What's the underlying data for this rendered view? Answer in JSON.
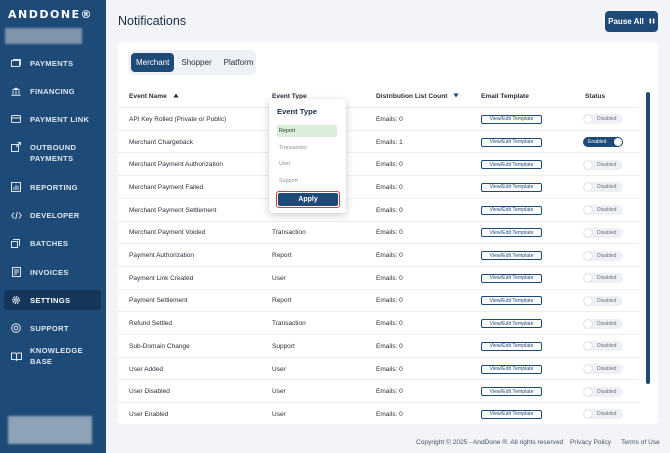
{
  "brand": {
    "logo_text": "ANDDONE®"
  },
  "sidebar": {
    "items": [
      {
        "label": "PAYMENTS",
        "icon": "payments-icon"
      },
      {
        "label": "FINANCING",
        "icon": "bank-icon"
      },
      {
        "label": "PAYMENT LINK",
        "icon": "card-icon"
      },
      {
        "label": "OUTBOUND",
        "label2": "PAYMENTS",
        "icon": "outbound-icon"
      },
      {
        "label": "REPORTING",
        "icon": "report-icon"
      },
      {
        "label": "DEVELOPER",
        "icon": "code-icon"
      },
      {
        "label": "BATCHES",
        "icon": "batch-icon"
      },
      {
        "label": "INVOICES",
        "icon": "invoice-icon"
      },
      {
        "label": "SETTINGS",
        "icon": "gear-icon",
        "active": true
      },
      {
        "label": "SUPPORT",
        "icon": "support-icon"
      },
      {
        "label": "KNOWLEDGE BASE",
        "icon": "book-icon"
      }
    ]
  },
  "header": {
    "title": "Notifications",
    "pause_label": "Pause All",
    "pause_icon": "pause-icon"
  },
  "tabs": [
    {
      "label": "Merchant",
      "active": true
    },
    {
      "label": "Shopper"
    },
    {
      "label": "Platform"
    }
  ],
  "table": {
    "columns": {
      "event_name": "Event Name",
      "event_type": "Event Type",
      "distribution": "Distribution List Count",
      "email_template": "Email Template",
      "status": "Status"
    },
    "template_label": "View/Edit Template",
    "rows": [
      {
        "name": "API Key Rolled (Private or Public)",
        "type": "",
        "emails": "Emails: 0",
        "status": "Disabled",
        "on": false
      },
      {
        "name": "Merchant Chargeback",
        "type": "",
        "emails": "Emails: 1",
        "status": "Enabled",
        "on": true
      },
      {
        "name": "Merchant Payment Authorization",
        "type": "",
        "emails": "Emails: 0",
        "status": "Disabled",
        "on": false
      },
      {
        "name": "Merchant Payment Failed",
        "type": "",
        "emails": "Emails: 0",
        "status": "Disabled",
        "on": false
      },
      {
        "name": "Merchant Payment Settlement",
        "type": "",
        "emails": "Emails: 0",
        "status": "Disabled",
        "on": false
      },
      {
        "name": "Merchant Payment Voided",
        "type": "Transaction",
        "emails": "Emails: 0",
        "status": "Disabled",
        "on": false
      },
      {
        "name": "Payment Authorization",
        "type": "Report",
        "emails": "Emails: 0",
        "status": "Disabled",
        "on": false
      },
      {
        "name": "Payment Link Created",
        "type": "User",
        "emails": "Emails: 0",
        "status": "Disabled",
        "on": false
      },
      {
        "name": "Payment Settlement",
        "type": "Report",
        "emails": "Emails: 0",
        "status": "Disabled",
        "on": false
      },
      {
        "name": "Refund Settled",
        "type": "Transaction",
        "emails": "Emails: 0",
        "status": "Disabled",
        "on": false
      },
      {
        "name": "Sub-Domain Change",
        "type": "Support",
        "emails": "Emails: 0",
        "status": "Disabled",
        "on": false
      },
      {
        "name": "User Added",
        "type": "User",
        "emails": "Emails: 0",
        "status": "Disabled",
        "on": false
      },
      {
        "name": "User Disabled",
        "type": "User",
        "emails": "Emails: 0",
        "status": "Disabled",
        "on": false
      },
      {
        "name": "User Enabled",
        "type": "User",
        "emails": "Emails: 0",
        "status": "Disabled",
        "on": false
      }
    ]
  },
  "filter_popup": {
    "title": "Event Type",
    "options": [
      {
        "label": "Report",
        "selected": true
      },
      {
        "label": "Transaction"
      },
      {
        "label": "User"
      },
      {
        "label": "Support"
      }
    ],
    "apply_label": "Apply"
  },
  "footer": {
    "copyright": "Copyright © 2025 - AndDone ®. All rights reserved",
    "privacy": "Privacy Policy",
    "terms": "Terms of Use"
  },
  "colors": {
    "primary": "#1e4a77",
    "sidebar_active": "#14365a",
    "selected_option": "#d9efd9",
    "highlight_border": "#d23a3a"
  }
}
